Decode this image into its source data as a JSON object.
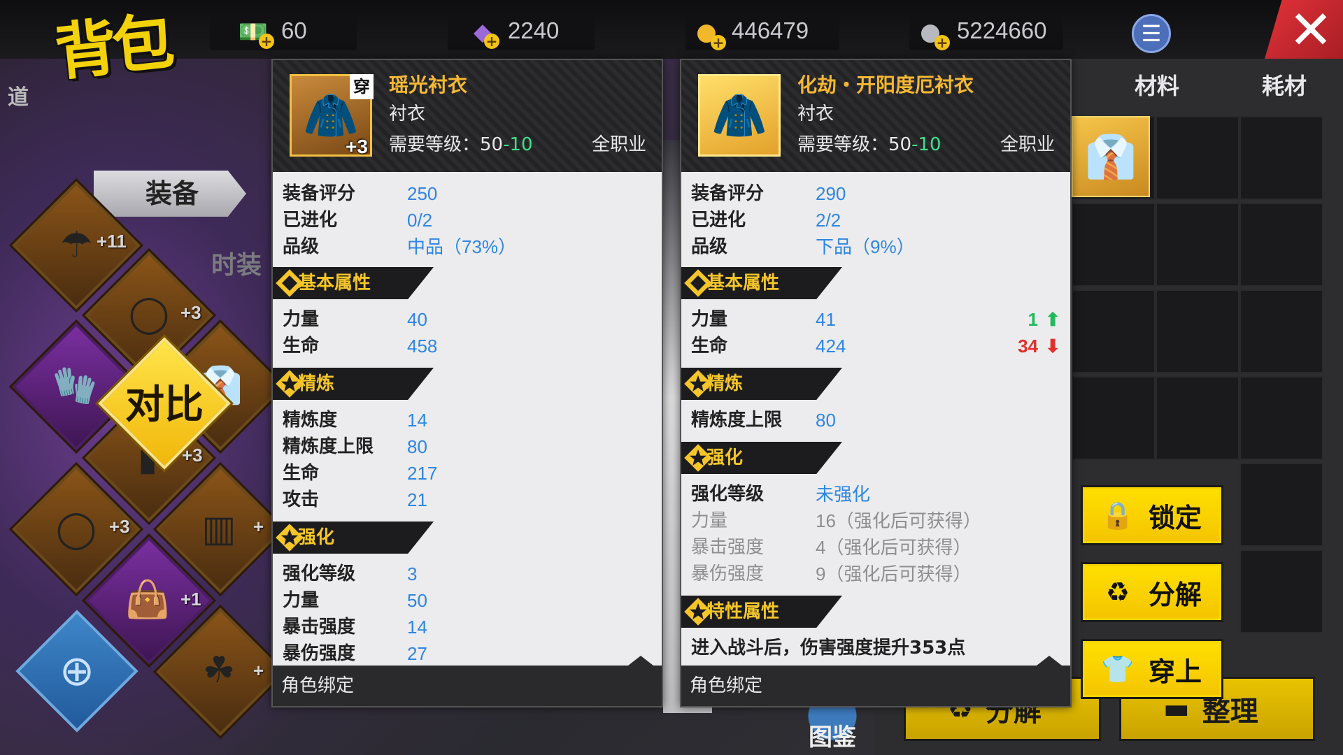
{
  "title": "背包",
  "resources": [
    {
      "name": "cash",
      "icon": "cash-icon",
      "value": "60"
    },
    {
      "name": "crystal",
      "icon": "crystal-icon",
      "value": "2240"
    },
    {
      "name": "gold",
      "icon": "gold-coin-icon",
      "value": "446479"
    },
    {
      "name": "silver",
      "icon": "silver-coin-icon",
      "value": "5224660"
    }
  ],
  "side_label": "道",
  "tabs_left": {
    "equipment": "装备",
    "fashion": "时装"
  },
  "tabs_right": {
    "materials": "材料",
    "consumables": "耗材"
  },
  "compare_label": "对比",
  "equip_slots": [
    {
      "icon": "umbrella-icon",
      "level": "+11"
    },
    {
      "icon": "belt-icon",
      "level": "+3"
    },
    {
      "icon": "gauntlet-icon",
      "level": ""
    },
    {
      "icon": "shirt-icon",
      "level": ""
    },
    {
      "icon": "bracer-icon",
      "level": "+3"
    },
    {
      "icon": "belt-icon",
      "level": "+3"
    },
    {
      "icon": "pants-icon",
      "level": "+"
    },
    {
      "icon": "bag-icon",
      "level": "+1"
    },
    {
      "icon": "necklace-icon",
      "level": "+"
    }
  ],
  "left_item": {
    "name": "瑶光衬衣",
    "wear_tag": "穿",
    "level": "+3",
    "type": "衬衣",
    "req_label": "需要等级：",
    "req_value": "50",
    "req_extra": "-10",
    "class": "全职业",
    "score_label": "装备评分",
    "score": "250",
    "evolve_label": "已进化",
    "evolve": "0/2",
    "grade_label": "品级",
    "grade": "中品（73%）",
    "sections": {
      "basic": "基本属性",
      "refine": "精炼",
      "enhance": "强化"
    },
    "basic": [
      {
        "label": "力量",
        "value": "40"
      },
      {
        "label": "生命",
        "value": "458"
      }
    ],
    "refine": [
      {
        "label": "精炼度",
        "value": "14"
      },
      {
        "label": "精炼度上限",
        "value": "80"
      },
      {
        "label": "生命",
        "value": "217"
      },
      {
        "label": "攻击",
        "value": "21"
      }
    ],
    "enhance": [
      {
        "label": "强化等级",
        "value": "3"
      },
      {
        "label": "力量",
        "value": "50"
      },
      {
        "label": "暴击强度",
        "value": "14"
      },
      {
        "label": "暴伤强度",
        "value": "27"
      }
    ],
    "footer": "角色绑定"
  },
  "right_item": {
    "name": "化劫・开阳度厄衬衣",
    "type": "衬衣",
    "req_label": "需要等级：",
    "req_value": "50",
    "req_extra": "-10",
    "class": "全职业",
    "score_label": "装备评分",
    "score": "290",
    "evolve_label": "已进化",
    "evolve": "2/2",
    "grade_label": "品级",
    "grade": "下品（9%）",
    "sections": {
      "basic": "基本属性",
      "refine": "精炼",
      "enhance": "强化",
      "trait": "特性属性"
    },
    "basic": [
      {
        "label": "力量",
        "value": "41",
        "delta": "1",
        "dir": "up"
      },
      {
        "label": "生命",
        "value": "424",
        "delta": "34",
        "dir": "down"
      }
    ],
    "refine": [
      {
        "label": "精炼度上限",
        "value": "80"
      }
    ],
    "enhance_level_label": "强化等级",
    "enhance_level": "未强化",
    "enhance_preview": [
      {
        "label": "力量",
        "value": "16（强化后可获得）"
      },
      {
        "label": "暴击强度",
        "value": "4（强化后可获得）"
      },
      {
        "label": "暴伤强度",
        "value": "9（强化后可获得）"
      }
    ],
    "trait": "进入战斗后，伤害强度提升353点",
    "footer": "角色绑定"
  },
  "actions": {
    "lock": "锁定",
    "decompose": "分解",
    "equip": "穿上"
  },
  "bottom": {
    "decompose": "分解",
    "sort": "整理",
    "atlas": "图鉴"
  },
  "colors": {
    "accent": "#f4c400",
    "value_blue": "#2d86e0",
    "up_green": "#1fbb5a",
    "down_red": "#e0302a",
    "name_orange": "#f5b834"
  }
}
